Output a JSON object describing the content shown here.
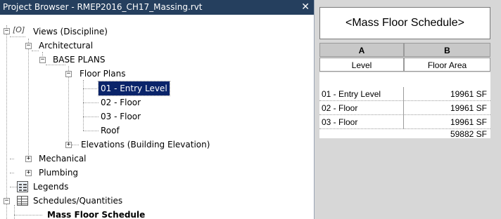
{
  "project_browser": {
    "title": "Project Browser - RMEP2016_CH17_Massing.rvt",
    "close_glyph": "✕",
    "tree": {
      "views": "Views (Discipline)",
      "views_icon": "[O]",
      "architectural": "Architectural",
      "base_plans": "BASE PLANS",
      "floor_plans": "Floor Plans",
      "entry_level": "01 - Entry Level",
      "floor_02": "02 - Floor",
      "floor_03": "03 - Floor",
      "roof": "Roof",
      "elevations": "Elevations (Building Elevation)",
      "mechanical": "Mechanical",
      "plumbing": "Plumbing",
      "legends": "Legends",
      "schedules": "Schedules/Quantities",
      "mass_floor_schedule": "Mass Floor Schedule"
    },
    "expand_minus": "−",
    "expand_plus": "+"
  },
  "schedule": {
    "title": "<Mass Floor Schedule>",
    "col_letters": [
      "A",
      "B"
    ],
    "col_names": [
      "Level",
      "Floor Area"
    ],
    "rows": [
      {
        "level": "01 - Entry Level",
        "area": "19961 SF"
      },
      {
        "level": "02 - Floor",
        "area": "19961 SF"
      },
      {
        "level": "03 - Floor",
        "area": "19961 SF"
      }
    ],
    "total": "59882 SF"
  }
}
